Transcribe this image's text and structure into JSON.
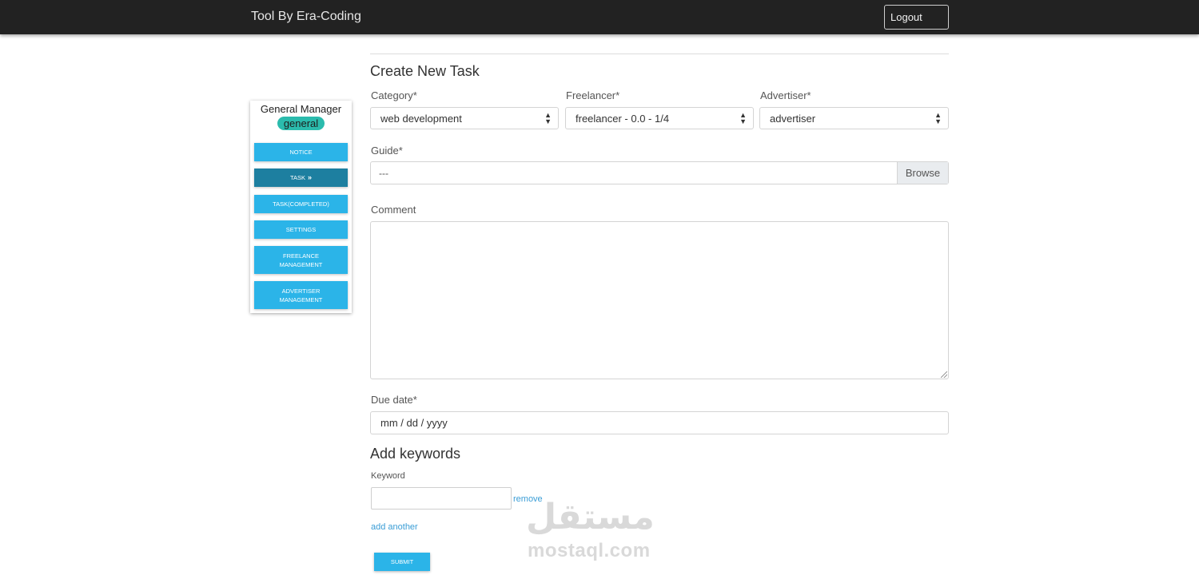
{
  "header": {
    "brand": "Tool By Era-Coding",
    "logout_label": "Logout"
  },
  "sidebar": {
    "role_title": "General Manager",
    "role_badge": "general",
    "items": [
      {
        "label": "NOTICE",
        "active": false
      },
      {
        "label": "TASK",
        "active": true
      },
      {
        "label": "TASK(COMPLETED)",
        "active": false
      },
      {
        "label": "SETTINGS",
        "active": false
      },
      {
        "label": "FREELANCE MANAGEMENT",
        "active": false
      },
      {
        "label": "ADVERTISER MANAGEMENT",
        "active": false
      }
    ],
    "active_marker": "»"
  },
  "form": {
    "title": "Create New Task",
    "category": {
      "label": "Category*",
      "value": "web development"
    },
    "freelancer": {
      "label": "Freelancer*",
      "value": "freelancer - 0.0 - 1/4"
    },
    "advertiser": {
      "label": "Advertiser*",
      "value": "advertiser"
    },
    "guide": {
      "label": "Guide*",
      "value": "---",
      "browse_label": "Browse"
    },
    "comment": {
      "label": "Comment",
      "value": ""
    },
    "due_date": {
      "label": "Due date*",
      "placeholder": "mm / dd / yyyy"
    },
    "keywords": {
      "title": "Add keywords",
      "keyword_label": "Keyword",
      "keyword_value": "",
      "remove_label": "remove",
      "add_another_label": "add another"
    },
    "submit_label": "SUBMIT"
  },
  "watermark": {
    "arabic": "مستقل",
    "latin": "mostaql.com"
  },
  "colors": {
    "topbar": "#222222",
    "nav_button": "#2bb4e8",
    "nav_button_active": "#1d7fa0",
    "badge": "#2bbbad",
    "link": "#3a9dd6"
  }
}
